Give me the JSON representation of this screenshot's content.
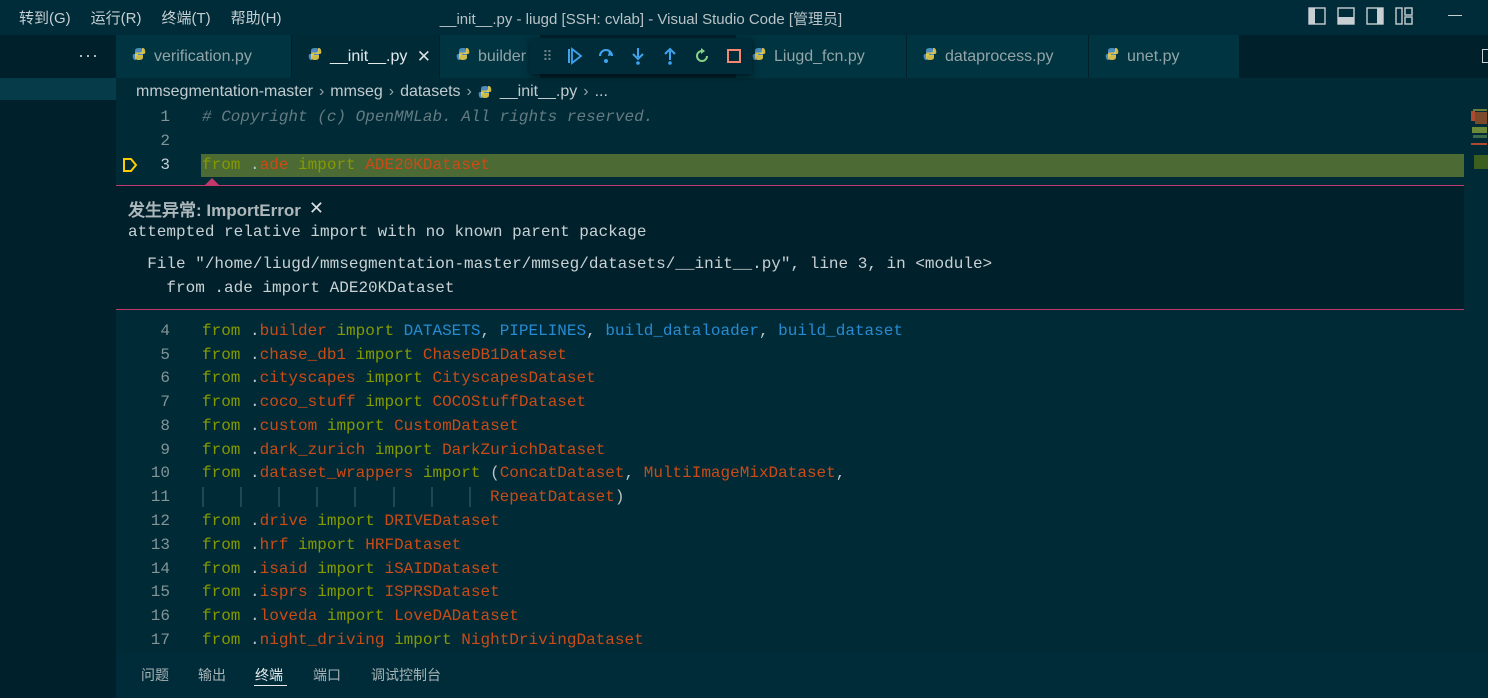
{
  "menu": [
    "转到(G)",
    "运行(R)",
    "终端(T)",
    "帮助(H)"
  ],
  "window_title": "__init__.py - liugd [SSH: cvlab] - Visual Studio Code [管理员]",
  "title_icons": [
    "toggle-primary-sidebar-icon",
    "toggle-panel-icon",
    "toggle-secondary-sidebar-icon",
    "customize-layout-icon",
    "minimize-icon"
  ],
  "sidebar": {
    "more": "···"
  },
  "tabs": [
    {
      "label": "verification.py"
    },
    {
      "label": "__init__.py",
      "close": "✕"
    },
    {
      "label": "builder"
    },
    {
      "label": "Liugd_fcn.py"
    },
    {
      "label": "dataprocess.py"
    },
    {
      "label": "unet.py"
    }
  ],
  "debug_toolbar": {
    "grip": "⠿",
    "buttons": [
      "continue-icon",
      "step-over-icon",
      "step-into-icon",
      "step-out-icon",
      "restart-icon",
      "stop-icon"
    ]
  },
  "breadcrumb": [
    "mmsegmentation-master",
    "mmseg",
    "datasets",
    "__init__.py",
    "..."
  ],
  "exception": {
    "title": "发生异常: ImportError",
    "close": "✕",
    "message": "attempted relative import with no known parent package",
    "trace1": "  File \"/home/liugd/mmsegmentation-master/mmseg/datasets/__init__.py\", line 3, in <module>",
    "trace2": "    from .ade import ADE20KDataset"
  },
  "code_lines": [
    {
      "n": "1",
      "text": "# Copyright (c) OpenMMLab. All rights reserved."
    },
    {
      "n": "2",
      "text": ""
    },
    {
      "n": "3",
      "text": "from .ade import ADE20KDataset"
    },
    {
      "n": "4",
      "text": "from .builder import DATASETS, PIPELINES, build_dataloader, build_dataset"
    },
    {
      "n": "5",
      "text": "from .chase_db1 import ChaseDB1Dataset"
    },
    {
      "n": "6",
      "text": "from .cityscapes import CityscapesDataset"
    },
    {
      "n": "7",
      "text": "from .coco_stuff import COCOStuffDataset"
    },
    {
      "n": "8",
      "text": "from .custom import CustomDataset"
    },
    {
      "n": "9",
      "text": "from .dark_zurich import DarkZurichDataset"
    },
    {
      "n": "10",
      "text": "from .dataset_wrappers import (ConcatDataset, MultiImageMixDataset,"
    },
    {
      "n": "11",
      "text": "                              RepeatDataset)"
    },
    {
      "n": "12",
      "text": "from .drive import DRIVEDataset"
    },
    {
      "n": "13",
      "text": "from .hrf import HRFDataset"
    },
    {
      "n": "14",
      "text": "from .isaid import iSAIDDataset"
    },
    {
      "n": "15",
      "text": "from .isprs import ISPRSDataset"
    },
    {
      "n": "16",
      "text": "from .loveda import LoveDADataset"
    },
    {
      "n": "17",
      "text": "from .night_driving import NightDrivingDataset"
    }
  ],
  "panel_tabs": [
    "问题",
    "输出",
    "终端",
    "端口",
    "调试控制台"
  ],
  "colors": {
    "background": "#002b36",
    "keyword": "#859900",
    "module": "#cb4b16",
    "class": "#d33682",
    "builtin": "#268bd2",
    "comment": "#657b83",
    "exception_border": "#c2386a",
    "current_line": "#4b6a34",
    "breakpoint": "#ffcc00"
  }
}
